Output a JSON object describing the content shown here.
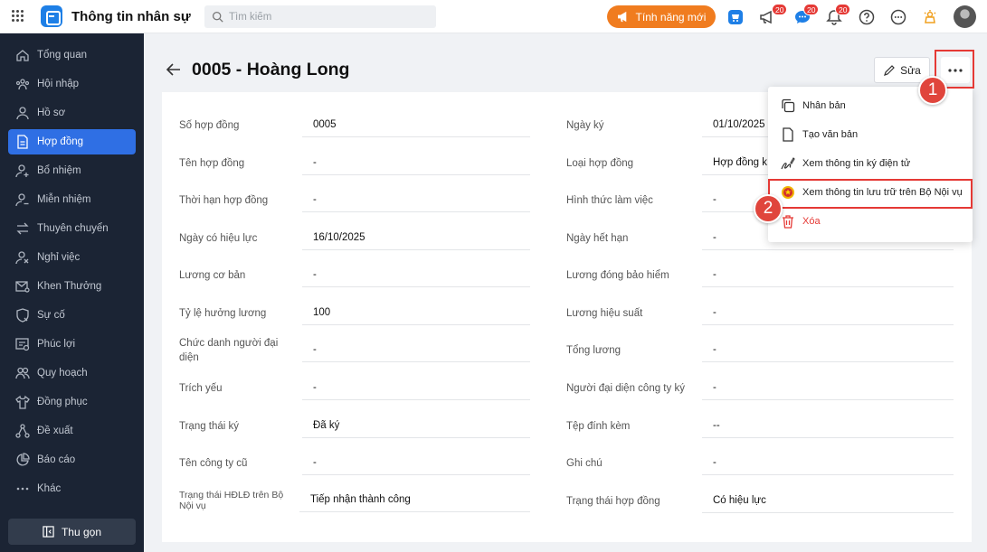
{
  "app": {
    "title": "Thông tin nhân sự"
  },
  "search": {
    "placeholder": "Tìm kiếm"
  },
  "header": {
    "new_feature_label": "Tính năng mới",
    "badges": [
      "20",
      "20",
      "20"
    ]
  },
  "sidebar": {
    "items": [
      {
        "label": "Tổng quan",
        "icon": "home-icon"
      },
      {
        "label": "Hội nhập",
        "icon": "team-icon"
      },
      {
        "label": "Hồ sơ",
        "icon": "user-icon"
      },
      {
        "label": "Hợp đồng",
        "icon": "document-icon",
        "active": true
      },
      {
        "label": "Bổ nhiệm",
        "icon": "user-add-icon"
      },
      {
        "label": "Miễn nhiệm",
        "icon": "user-remove-icon"
      },
      {
        "label": "Thuyên chuyển",
        "icon": "transfer-icon"
      },
      {
        "label": "Nghỉ việc",
        "icon": "user-leave-icon"
      },
      {
        "label": "Khen Thưởng",
        "icon": "mail-award-icon"
      },
      {
        "label": "Sự cố",
        "icon": "shield-alert-icon"
      },
      {
        "label": "Phúc lợi",
        "icon": "benefit-icon"
      },
      {
        "label": "Quy hoạch",
        "icon": "group-icon"
      },
      {
        "label": "Đồng phục",
        "icon": "shirt-icon"
      },
      {
        "label": "Đề xuất",
        "icon": "flow-icon"
      },
      {
        "label": "Báo cáo",
        "icon": "pie-chart-icon"
      },
      {
        "label": "Khác",
        "icon": "more-icon"
      }
    ],
    "collapse_label": "Thu gọn"
  },
  "page": {
    "title": "0005 - Hoàng Long",
    "edit_label": "Sửa"
  },
  "fields_left": [
    {
      "label": "Số hợp đồng",
      "value": "0005"
    },
    {
      "label": "Tên hợp đồng",
      "value": "-"
    },
    {
      "label": "Thời hạn hợp đồng",
      "value": "-"
    },
    {
      "label": "Ngày có hiệu lực",
      "value": "16/10/2025"
    },
    {
      "label": "Lương cơ bản",
      "value": "-"
    },
    {
      "label": "Tỷ lệ hưởng lương",
      "value": "100"
    },
    {
      "label": "Chức danh người đại diện",
      "value": "-"
    },
    {
      "label": "Trích yếu",
      "value": "-"
    },
    {
      "label": "Trạng thái ký",
      "value": "Đã ký"
    },
    {
      "label": "Tên công ty cũ",
      "value": "-"
    },
    {
      "label": "Trạng thái HĐLĐ trên Bộ Nội vụ",
      "value": "Tiếp nhận thành công"
    }
  ],
  "fields_right": [
    {
      "label": "Ngày ký",
      "value": "01/10/2025"
    },
    {
      "label": "Loại hợp đồng",
      "value": "Hợp đồng k"
    },
    {
      "label": "Hình thức làm việc",
      "value": "-"
    },
    {
      "label": "Ngày hết hạn",
      "value": "-"
    },
    {
      "label": "Lương đóng bảo hiểm",
      "value": "-"
    },
    {
      "label": "Lương hiệu suất",
      "value": "-"
    },
    {
      "label": "Tổng lương",
      "value": "-"
    },
    {
      "label": "Người đại diện công ty ký",
      "value": "-"
    },
    {
      "label": "Tệp đính kèm",
      "value": "--"
    },
    {
      "label": "Ghi chú",
      "value": "-"
    },
    {
      "label": "Trạng thái hợp đồng",
      "value": "Có hiệu lực"
    }
  ],
  "menu": {
    "items": [
      {
        "label": "Nhân bản",
        "icon": "copy-icon"
      },
      {
        "label": "Tạo văn bản",
        "icon": "file-icon"
      },
      {
        "label": "Xem thông tin ký điện tử",
        "icon": "signature-icon"
      },
      {
        "label": "Xem thông tin lưu trữ trên Bộ Nội vụ",
        "icon": "emblem-icon"
      },
      {
        "label": "Xóa",
        "icon": "trash-icon",
        "danger": true
      }
    ]
  },
  "annotations": {
    "step1": "1",
    "step2": "2"
  },
  "colors": {
    "accent": "#2f6fe4",
    "sidebar_bg": "#1b2434",
    "danger": "#e53935",
    "highlight": "#f07c1f"
  }
}
